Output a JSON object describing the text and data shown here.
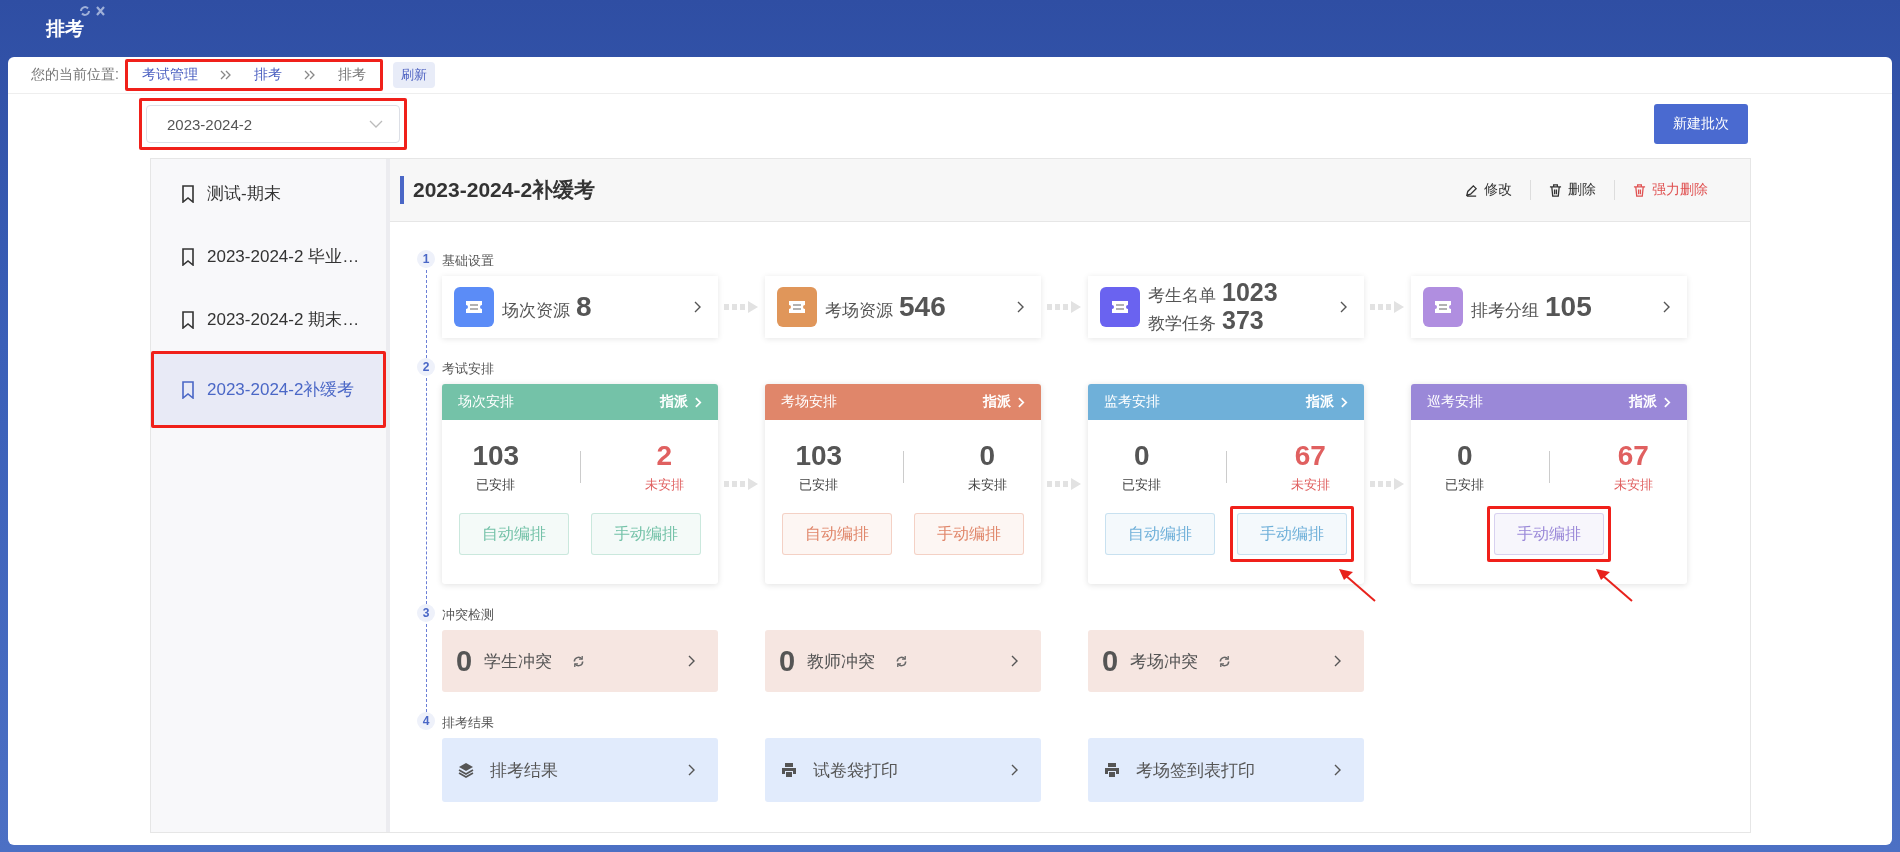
{
  "header": {
    "title": "排考"
  },
  "breadcrumb": {
    "label": "您的当前位置:",
    "items": [
      {
        "text": "考试管理",
        "kind": "link"
      },
      {
        "text": "排考",
        "kind": "link"
      },
      {
        "text": "排考",
        "kind": "current"
      }
    ],
    "refresh": "刷新",
    "annotated": true
  },
  "term_select": {
    "value": "2023-2024-2",
    "annotated": true
  },
  "new_batch_button": "新建批次",
  "batches": [
    {
      "name": "测试-期末",
      "selected": false,
      "annotated": false
    },
    {
      "name": "2023-2024-2 毕业…",
      "selected": false,
      "annotated": false
    },
    {
      "name": "2023-2024-2 期末…",
      "selected": false,
      "annotated": false
    },
    {
      "name": "2023-2024-2补缓考",
      "selected": true,
      "annotated": true
    }
  ],
  "detail": {
    "title": "2023-2024-2补缓考",
    "actions": [
      {
        "label": "修改",
        "kind": "edit"
      },
      {
        "label": "删除",
        "kind": "delete"
      },
      {
        "label": "强力删除",
        "kind": "force-delete"
      }
    ],
    "basic": {
      "number": "1",
      "title": "基础设置",
      "cards": [
        {
          "color": "#5b8cf7",
          "lines": [
            {
              "label": "场次资源",
              "value": "8"
            }
          ]
        },
        {
          "color": "#e0965a",
          "lines": [
            {
              "label": "考场资源",
              "value": "546"
            }
          ]
        },
        {
          "color": "#6a63f0",
          "lines": [
            {
              "label": "考生名单",
              "value": "1023"
            },
            {
              "label": "教学任务",
              "value": "373"
            }
          ]
        },
        {
          "color": "#b08ee0",
          "lines": [
            {
              "label": "排考分组",
              "value": "105"
            }
          ]
        }
      ]
    },
    "arrangement": {
      "number": "2",
      "title": "考试安排",
      "cards": [
        {
          "title": "场次安排",
          "assign": "指派",
          "color": "#74c2a8",
          "arranged": "103",
          "arranged_label": "已安排",
          "unarranged": "2",
          "unarranged_label": "未安排",
          "warning": true,
          "buttons": [
            {
              "label": "自动编排",
              "annotated": false
            },
            {
              "label": "手动编排",
              "annotated": false
            }
          ]
        },
        {
          "title": "考场安排",
          "assign": "指派",
          "color": "#e0866a",
          "arranged": "103",
          "arranged_label": "已安排",
          "unarranged": "0",
          "unarranged_label": "未安排",
          "warning": false,
          "buttons": [
            {
              "label": "自动编排",
              "annotated": false
            },
            {
              "label": "手动编排",
              "annotated": false
            }
          ]
        },
        {
          "title": "监考安排",
          "assign": "指派",
          "color": "#6fb0d9",
          "arranged": "0",
          "arranged_label": "已安排",
          "unarranged": "67",
          "unarranged_label": "未安排",
          "warning": true,
          "buttons": [
            {
              "label": "自动编排",
              "annotated": false
            },
            {
              "label": "手动编排",
              "annotated": true
            }
          ]
        },
        {
          "title": "巡考安排",
          "assign": "指派",
          "color": "#9a88d8",
          "arranged": "0",
          "arranged_label": "已安排",
          "unarranged": "67",
          "unarranged_label": "未安排",
          "warning": true,
          "buttons": [
            {
              "label": "手动编排",
              "annotated": true
            }
          ]
        }
      ]
    },
    "conflicts": {
      "number": "3",
      "title": "冲突检测",
      "cards": [
        {
          "count": "0",
          "label": "学生冲突"
        },
        {
          "count": "0",
          "label": "教师冲突"
        },
        {
          "count": "0",
          "label": "考场冲突"
        }
      ]
    },
    "results": {
      "number": "4",
      "title": "排考结果",
      "cards": [
        {
          "label": "排考结果",
          "kind": "layers"
        },
        {
          "label": "试卷袋打印",
          "kind": "printer"
        },
        {
          "label": "考场签到表打印",
          "kind": "printer"
        }
      ]
    }
  }
}
